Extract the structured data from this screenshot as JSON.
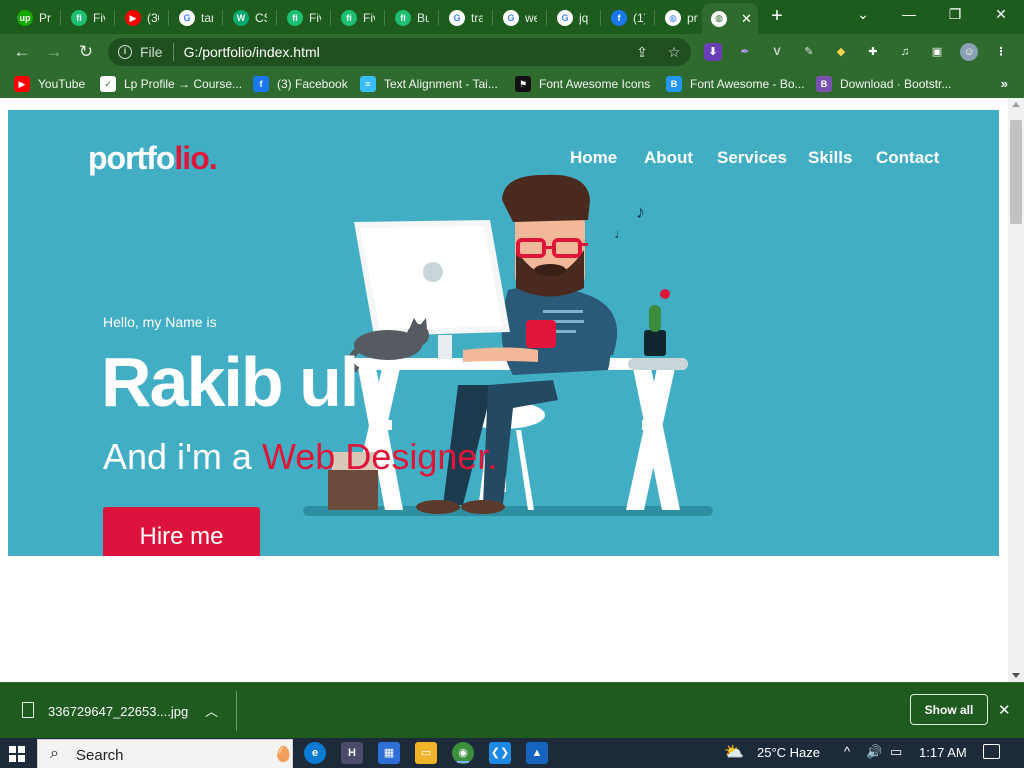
{
  "browser": {
    "tabs": [
      {
        "title": "Pr",
        "icon": "upwork-icon",
        "color": "#14a800",
        "glyph": "up"
      },
      {
        "title": "Fiv",
        "icon": "fiverr-icon",
        "color": "#1dbf73",
        "glyph": "fi"
      },
      {
        "title": "(30",
        "icon": "youtube-icon",
        "color": "#ff0000",
        "glyph": "▶"
      },
      {
        "title": "tar",
        "icon": "google-icon",
        "color": "#ffffff",
        "glyph": "G"
      },
      {
        "title": "CS",
        "icon": "w3schools-icon",
        "color": "#04aa6d",
        "glyph": "W"
      },
      {
        "title": "Fiv",
        "icon": "fiverr-icon",
        "color": "#1dbf73",
        "glyph": "fi"
      },
      {
        "title": "Fiv",
        "icon": "fiverr-icon",
        "color": "#1dbf73",
        "glyph": "fi"
      },
      {
        "title": "Bu",
        "icon": "fiverr-icon",
        "color": "#1dbf73",
        "glyph": "fi"
      },
      {
        "title": "tra",
        "icon": "google-icon",
        "color": "#ffffff",
        "glyph": "G"
      },
      {
        "title": "we",
        "icon": "google-icon",
        "color": "#ffffff",
        "glyph": "G"
      },
      {
        "title": "jq",
        "icon": "google-icon",
        "color": "#ffffff",
        "glyph": "G"
      },
      {
        "title": "(1)",
        "icon": "facebook-icon",
        "color": "#1877f2",
        "glyph": "f"
      },
      {
        "title": "pr",
        "icon": "globe-icon",
        "color": "#ffffff",
        "glyph": "◍"
      }
    ],
    "active_tab": {
      "icon": "globe-icon",
      "glyph": "◍"
    },
    "url_scheme": "File",
    "url": "G:/portfolio/index.html"
  },
  "bookmarks": [
    {
      "label": "YouTube",
      "icon": "youtube-icon",
      "color": "#ff0000",
      "glyph": "▶"
    },
    {
      "label": "Lp Profile → Course...",
      "icon": "course-icon",
      "color": "#ffffff",
      "glyph": "✓"
    },
    {
      "label": "(3) Facebook",
      "icon": "facebook-icon",
      "color": "#1877f2",
      "glyph": "f"
    },
    {
      "label": "Text Alignment - Tai...",
      "icon": "tailwind-icon",
      "color": "#38bdf8",
      "glyph": "≈"
    },
    {
      "label": "Font Awesome Icons",
      "icon": "flag-icon",
      "color": "#111111",
      "glyph": "⚑"
    },
    {
      "label": "Font Awesome - Bo...",
      "icon": "bookmark-b-icon",
      "color": "#2196f3",
      "glyph": "B"
    },
    {
      "label": "Download · Bootstr...",
      "icon": "bootstrap-icon",
      "color": "#7952b3",
      "glyph": "B"
    }
  ],
  "page": {
    "logo_main": "portfo",
    "logo_accent": "lio.",
    "nav": [
      "Home",
      "About",
      "Services",
      "Skills",
      "Contact"
    ],
    "greeting": "Hello, my Name is",
    "name": "Rakib ul",
    "role_prefix": "And i'm a ",
    "role_accent": "Web Designer.",
    "hire_button": "Hire me",
    "colors": {
      "hero_bg": "#41aec4",
      "accent": "#e0153a",
      "button": "#dc143c"
    }
  },
  "downloads": {
    "file_name": "336729647_22653....jpg",
    "show_all": "Show all"
  },
  "taskbar": {
    "search_placeholder": "Search",
    "weather": "25°C  Haze",
    "time": "1:17 AM"
  }
}
